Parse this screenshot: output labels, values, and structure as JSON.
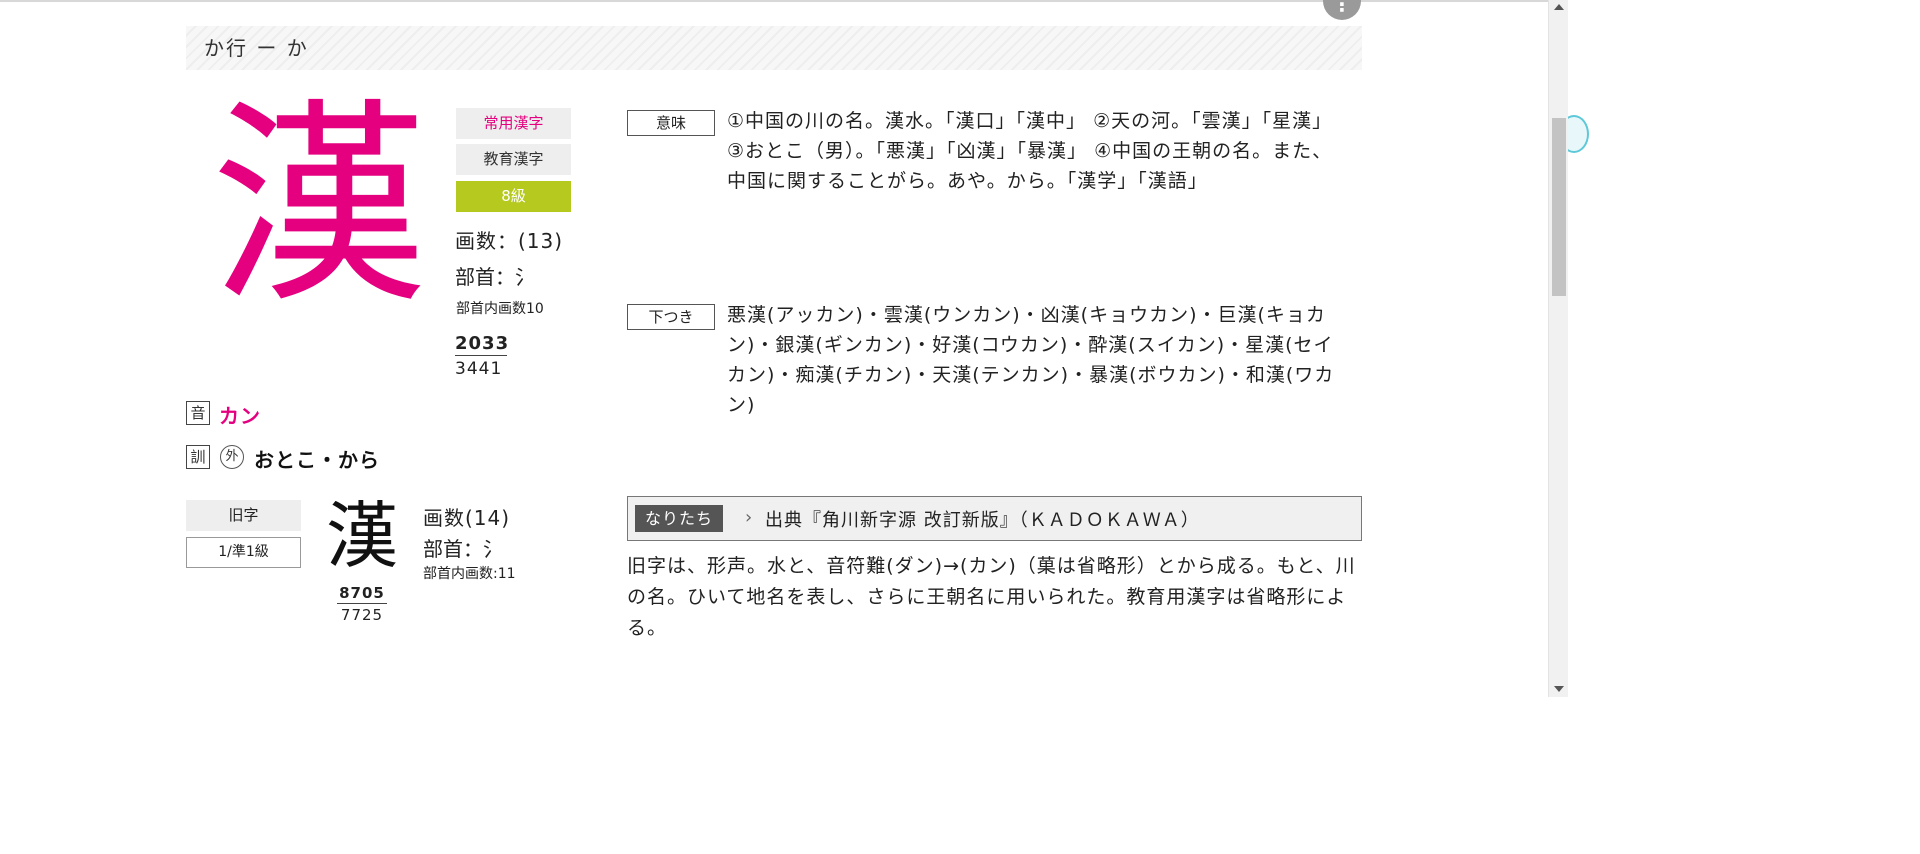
{
  "section": {
    "title": "か行 ー か",
    "more_icon": "⋮"
  },
  "kanji": {
    "character": "漢",
    "color": "#e4007f",
    "badges": {
      "joyo": "常用漢字",
      "kyoiku": "教育漢字",
      "kyu": "8級"
    },
    "stroke_count": "画数：(13)",
    "radical": "部首：氵",
    "radical_strokes": "部首内画数10",
    "jis_code": "2033",
    "unicode_index": "3441"
  },
  "readings": {
    "on_label": "音",
    "on": "カン",
    "kun_label": "訓",
    "gai_label": "外",
    "kun": "おとこ・から"
  },
  "old_form": {
    "label": "旧字",
    "level": "1/準1級",
    "character": "漢",
    "stroke_count": "画数(14)",
    "radical": "部首：氵",
    "radical_strokes": "部首内画数:11",
    "jis_code": "8705",
    "unicode_index": "7725"
  },
  "meaning": {
    "tag": "意味",
    "text": "①中国の川の名。漢水。「漢口」「漢中」 ②天の河。「雲漢」「星漢」 ③おとこ（男）。「悪漢」「凶漢」「暴漢」 ④中国の王朝の名。また、中国に関することがら。あや。から。「漢学」「漢語」"
  },
  "shitatsuki": {
    "tag": "下つき",
    "text": "悪漢(アッカン)・雲漢(ウンカン)・凶漢(キョウカン)・巨漢(キョカン)・銀漢(ギンカン)・好漢(コウカン)・酔漢(スイカン)・星漢(セイカン)・痴漢(チカン)・天漢(テンカン)・暴漢(ボウカン)・和漢(ワカン)"
  },
  "naritachi": {
    "tag": "なりたち",
    "source": "出典『角川新字源 改訂新版』（ＫＡＤＯＫＡＷＡ）",
    "text": "旧字は、形声。水と、音符難(ダン)→(カン)（菓は省略形）とから成る。もと、川の名。ひいて地名を表し、さらに王朝名に用いられた。教育用漢字は省略形による。"
  },
  "colors": {
    "accent": "#e4007f",
    "level_badge": "#b5c91e",
    "tag_dark": "#555555"
  }
}
